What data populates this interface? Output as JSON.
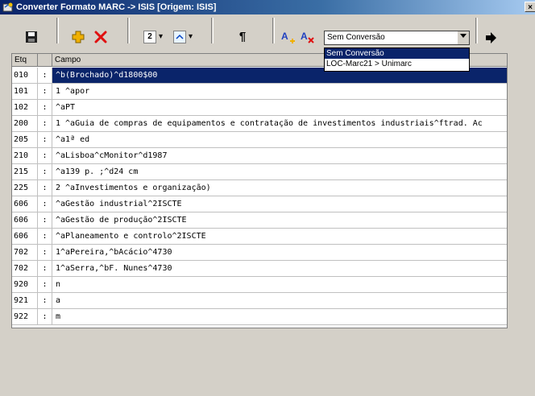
{
  "window": {
    "title": "Converter Formato MARC -> ISIS [Origem: ISIS]",
    "close_glyph": "×"
  },
  "toolbar": {
    "save_icon": "save-icon",
    "add_icon": "add-icon",
    "delete_icon": "delete-icon",
    "level_value": "2",
    "level_chevron": "▾",
    "font_chevron": "▾",
    "pilcrow": "¶",
    "conversion_combo": {
      "value": "Sem Conversão"
    },
    "arrow_icon": "arrow-right-icon"
  },
  "dropdown": {
    "options": [
      "Sem Conversão",
      "LOC-Marc21 > Unimarc"
    ],
    "selected_index": 0
  },
  "grid": {
    "headers": {
      "etq": "Etq",
      "campo": "Campo"
    },
    "separator": ":",
    "rows": [
      {
        "etq": "010",
        "campo": "^b(Brochado)^d1800$00",
        "selected": true
      },
      {
        "etq": "101",
        "campo": "1 ^apor"
      },
      {
        "etq": "102",
        "campo": " ^aPT"
      },
      {
        "etq": "200",
        "campo": "1 ^aGuia de compras de equipamentos e contratação de investimentos industriais^ftrad. Ac"
      },
      {
        "etq": "205",
        "campo": " ^a1ª ed"
      },
      {
        "etq": "210",
        "campo": " ^aLisboa^cMonitor^d1987"
      },
      {
        "etq": "215",
        "campo": " ^a139 p. ;^d24 cm"
      },
      {
        "etq": "225",
        "campo": "2 ^aInvestimentos e organização)"
      },
      {
        "etq": "606",
        "campo": " ^aGestão industrial^2ISCTE"
      },
      {
        "etq": "606",
        "campo": " ^aGestão de produção^2ISCTE"
      },
      {
        "etq": "606",
        "campo": " ^aPlaneamento e controlo^2ISCTE"
      },
      {
        "etq": "702",
        "campo": " 1^aPereira,^bAcácio^4730"
      },
      {
        "etq": "702",
        "campo": " 1^aSerra,^bF. Nunes^4730"
      },
      {
        "etq": "920",
        "campo": "n"
      },
      {
        "etq": "921",
        "campo": "a"
      },
      {
        "etq": "922",
        "campo": "m"
      }
    ]
  },
  "colors": {
    "selection": "#0a246a",
    "chrome": "#d4d0c8",
    "add": "#f0b000",
    "delete": "#e01010"
  }
}
